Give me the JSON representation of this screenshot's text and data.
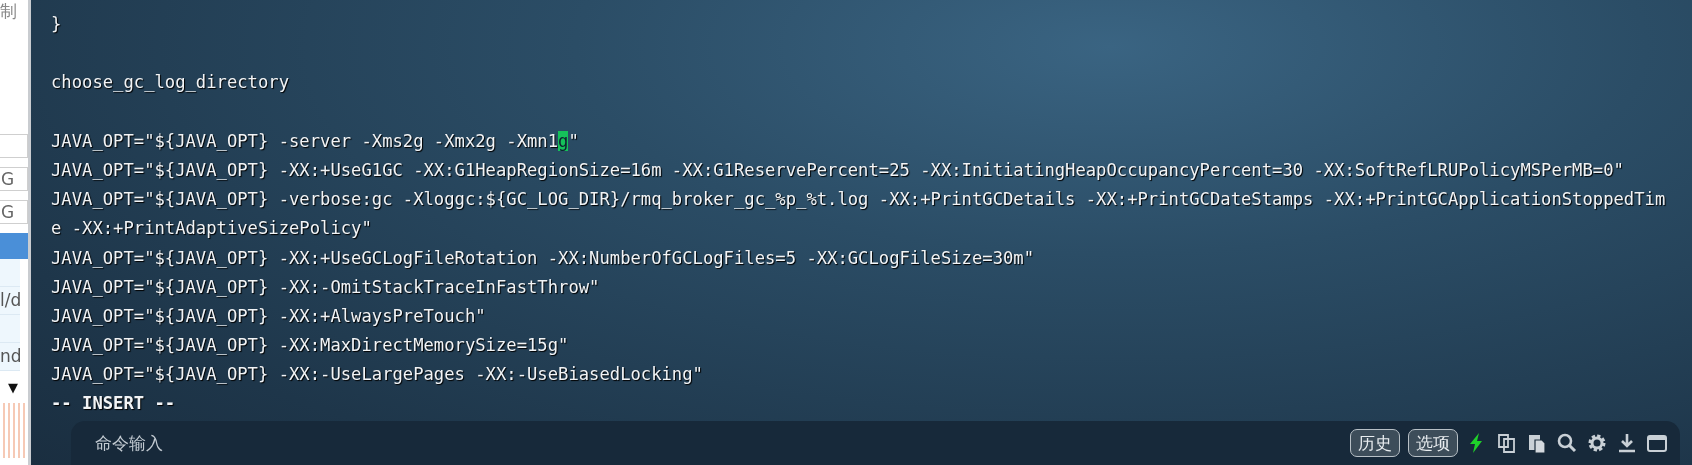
{
  "side_panel": {
    "items": [
      {
        "kind": "label",
        "text": "制"
      },
      {
        "kind": "field"
      },
      {
        "kind": "field",
        "text": "G"
      },
      {
        "kind": "field",
        "text": "G"
      },
      {
        "kind": "bar"
      },
      {
        "kind": "row"
      },
      {
        "kind": "row",
        "text": "l/d"
      },
      {
        "kind": "row"
      },
      {
        "kind": "row",
        "text": "nd"
      },
      {
        "kind": "toggle",
        "text": "▼"
      }
    ]
  },
  "terminal": {
    "lines": [
      {
        "text": "}"
      },
      {
        "kind": "blank"
      },
      {
        "text": "choose_gc_log_directory"
      },
      {
        "kind": "blank"
      },
      {
        "before": "JAVA_OPT=\"${JAVA_OPT} -server -Xms2g -Xmx2g -Xmn1",
        "cursor": "g",
        "after": "\""
      },
      {
        "text": "JAVA_OPT=\"${JAVA_OPT} -XX:+UseG1GC -XX:G1HeapRegionSize=16m -XX:G1ReservePercent=25 -XX:InitiatingHeapOccupancyPercent=30 -XX:SoftRefLRUPolicyMSPerMB=0\""
      },
      {
        "text": "JAVA_OPT=\"${JAVA_OPT} -verbose:gc -Xloggc:${GC_LOG_DIR}/rmq_broker_gc_%p_%t.log -XX:+PrintGCDetails -XX:+PrintGCDateStamps -XX:+PrintGCApplicationStoppedTim"
      },
      {
        "text": "e -XX:+PrintAdaptiveSizePolicy\""
      },
      {
        "text": "JAVA_OPT=\"${JAVA_OPT} -XX:+UseGCLogFileRotation -XX:NumberOfGCLogFiles=5 -XX:GCLogFileSize=30m\""
      },
      {
        "text": "JAVA_OPT=\"${JAVA_OPT} -XX:-OmitStackTraceInFastThrow\""
      },
      {
        "text": "JAVA_OPT=\"${JAVA_OPT} -XX:+AlwaysPreTouch\""
      },
      {
        "text": "JAVA_OPT=\"${JAVA_OPT} -XX:MaxDirectMemorySize=15g\""
      },
      {
        "text": "JAVA_OPT=\"${JAVA_OPT} -XX:-UseLargePages -XX:-UseBiasedLocking\""
      },
      {
        "text": "-- INSERT --",
        "kind": "mode"
      }
    ]
  },
  "command_bar": {
    "placeholder": "命令输入",
    "buttons": [
      "历史",
      "选项"
    ],
    "tools": [
      {
        "kind": "bolt"
      },
      {
        "kind": "copy"
      },
      {
        "kind": "paste"
      },
      {
        "kind": "search"
      },
      {
        "kind": "settings"
      },
      {
        "kind": "download"
      },
      {
        "kind": "window"
      }
    ]
  }
}
